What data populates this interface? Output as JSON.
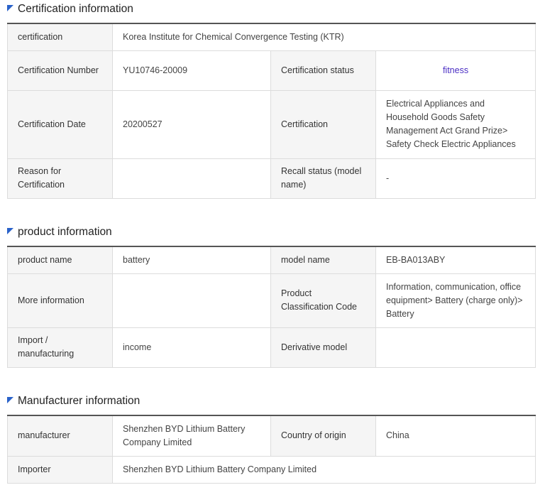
{
  "certification_section": {
    "title": "Certification information",
    "certification_label": "certification",
    "certification_value": "Korea Institute for Chemical Convergence Testing (KTR)",
    "cert_number_label": "Certification Number",
    "cert_number_value": "YU10746-20009",
    "cert_status_label": "Certification status",
    "cert_status_value": "fitness",
    "cert_date_label": "Certification Date",
    "cert_date_value": "20200527",
    "certification2_label": "Certification",
    "certification2_value": "Electrical Appliances and Household Goods Safety Management Act Grand Prize> Safety Check Electric Appliances",
    "reason_label": "Reason for Certification",
    "reason_value": "",
    "recall_label": "Recall status (model name)",
    "recall_value": "-"
  },
  "product_section": {
    "title": "product information",
    "product_name_label": "product name",
    "product_name_value": "battery",
    "model_name_label": "model name",
    "model_name_value": "EB-BA013ABY",
    "more_info_label": "More information",
    "more_info_value": "",
    "classification_label": "Product Classification Code",
    "classification_value": "Information, communication, office equipment> Battery (charge only)> Battery",
    "import_label": "Import / manufacturing",
    "import_value": "income",
    "derivative_label": "Derivative model",
    "derivative_value": ""
  },
  "manufacturer_section": {
    "title": "Manufacturer information",
    "manufacturer_label": "manufacturer",
    "manufacturer_value": "Shenzhen BYD Lithium Battery Company Limited",
    "country_label": "Country of origin",
    "country_value": "China",
    "importer_label": "Importer",
    "importer_value": "Shenzhen BYD Lithium Battery Company Limited"
  },
  "colors": {
    "accent_flag": "#2a62c9",
    "status_link": "#4b2fc4"
  }
}
